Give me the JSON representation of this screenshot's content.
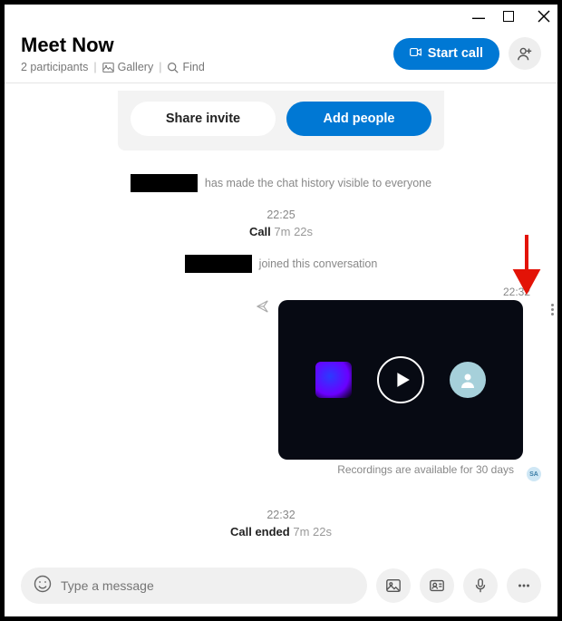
{
  "window": {
    "title": "Meet Now"
  },
  "header": {
    "participants_text": "2 participants",
    "gallery_label": "Gallery",
    "find_label": "Find",
    "start_call_label": "Start call"
  },
  "invite": {
    "share_label": "Share invite",
    "add_people_label": "Add people"
  },
  "chat": {
    "history_visible_suffix": "has made the chat history visible to everyone",
    "time1": "22:25",
    "call_label": "Call",
    "call_duration": "7m 22s",
    "joined_suffix": "joined this conversation",
    "recording_time": "22:32",
    "recording_note": "Recordings are available for 30 days",
    "status_badge": "SA",
    "time2": "22:32",
    "call_ended_label": "Call ended",
    "call_ended_duration": "7m 22s"
  },
  "composer": {
    "placeholder": "Type a message"
  }
}
